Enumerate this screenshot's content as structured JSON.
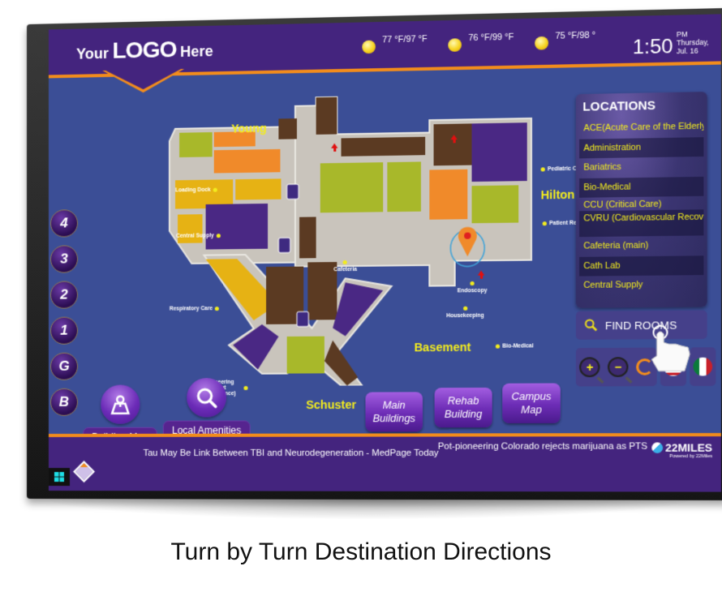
{
  "header": {
    "logo": {
      "prefix": "Your",
      "main": "LOGO",
      "suffix": "Here"
    },
    "weather": [
      {
        "icon": "sun-icon",
        "temp": "77 °F/97 °F"
      },
      {
        "icon": "sun-icon",
        "temp": "76 °F/99 °F"
      },
      {
        "icon": "sun-icon",
        "temp": "75 °F/98 °"
      }
    ],
    "clock": {
      "time": "1:50",
      "ampm": "PM",
      "date": "Thursday, Jul. 16"
    }
  },
  "map": {
    "buildings": [
      "Young",
      "Hilton",
      "Basement",
      "Schuster"
    ],
    "pois": [
      "Loading Dock",
      "Central Supply",
      "Respiratory Care",
      "Engineering (Plant maintenance)",
      "Cafeteria",
      "Endoscopy",
      "Housekeeping",
      "Bio-Medical",
      "Pediatric Oncology",
      "Patient Registration"
    ],
    "you_are_here": "YOU ARE HERE"
  },
  "floors": [
    "4",
    "3",
    "2",
    "1",
    "G",
    "B"
  ],
  "nav": {
    "building_map": "Building Map",
    "local_amenities": "Local Amenities",
    "buildings": [
      "Main Buildings",
      "Rehab Building",
      "Campus Map"
    ]
  },
  "locations": {
    "title": "LOCATIONS",
    "items": [
      "ACE(Acute Care of the Elderly)",
      "Administration",
      "Bariatrics",
      "Bio-Medical",
      "CCU (Critical Care)",
      "CVRU (Cardiovascular Recovery",
      "Cafeteria (main)",
      "Cath Lab",
      "Central Supply"
    ]
  },
  "find_rooms": "FIND ROOMS",
  "controls": {
    "zoom_in": "+",
    "zoom_out": "−",
    "reset": "Reset"
  },
  "footer": {
    "tickers": [
      "Tau May Be Link Between TBI and Neurodegeneration - MedPage Today",
      "Pot-pioneering Colorado rejects marijuana as PTS"
    ],
    "brand": "22MILES",
    "powered": "Powered by 22Miles"
  },
  "caption": "Turn by Turn Destination Directions"
}
